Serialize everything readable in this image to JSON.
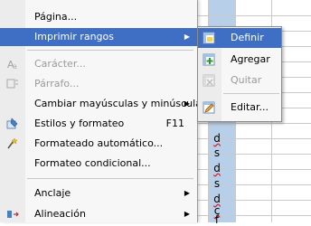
{
  "sheet": {
    "cells": [
      "d",
      "s",
      "d",
      "s",
      "d",
      "c",
      "f"
    ]
  },
  "menu": {
    "items": [
      {
        "label": "Página...",
        "state": "normal"
      },
      {
        "label": "Imprimir rangos",
        "state": "selected"
      },
      {
        "label": "Carácter...",
        "state": "disabled"
      },
      {
        "label": "Párrafo...",
        "state": "disabled"
      },
      {
        "label": "Cambiar mayúsculas y minúsculas",
        "state": "normal"
      },
      {
        "label": "Estilos y formateo",
        "shortcut": "F11",
        "state": "normal"
      },
      {
        "label": "Formateado automático...",
        "state": "normal"
      },
      {
        "label": "Formateo condicional...",
        "state": "normal"
      },
      {
        "label": "Anclaje",
        "state": "normal"
      },
      {
        "label": "Alineación",
        "state": "normal"
      }
    ]
  },
  "submenu": {
    "items": [
      {
        "label": "Definir",
        "state": "selected"
      },
      {
        "label": "Agregar",
        "state": "normal"
      },
      {
        "label": "Quitar",
        "state": "disabled"
      },
      {
        "label": "Editar...",
        "state": "normal"
      }
    ]
  }
}
